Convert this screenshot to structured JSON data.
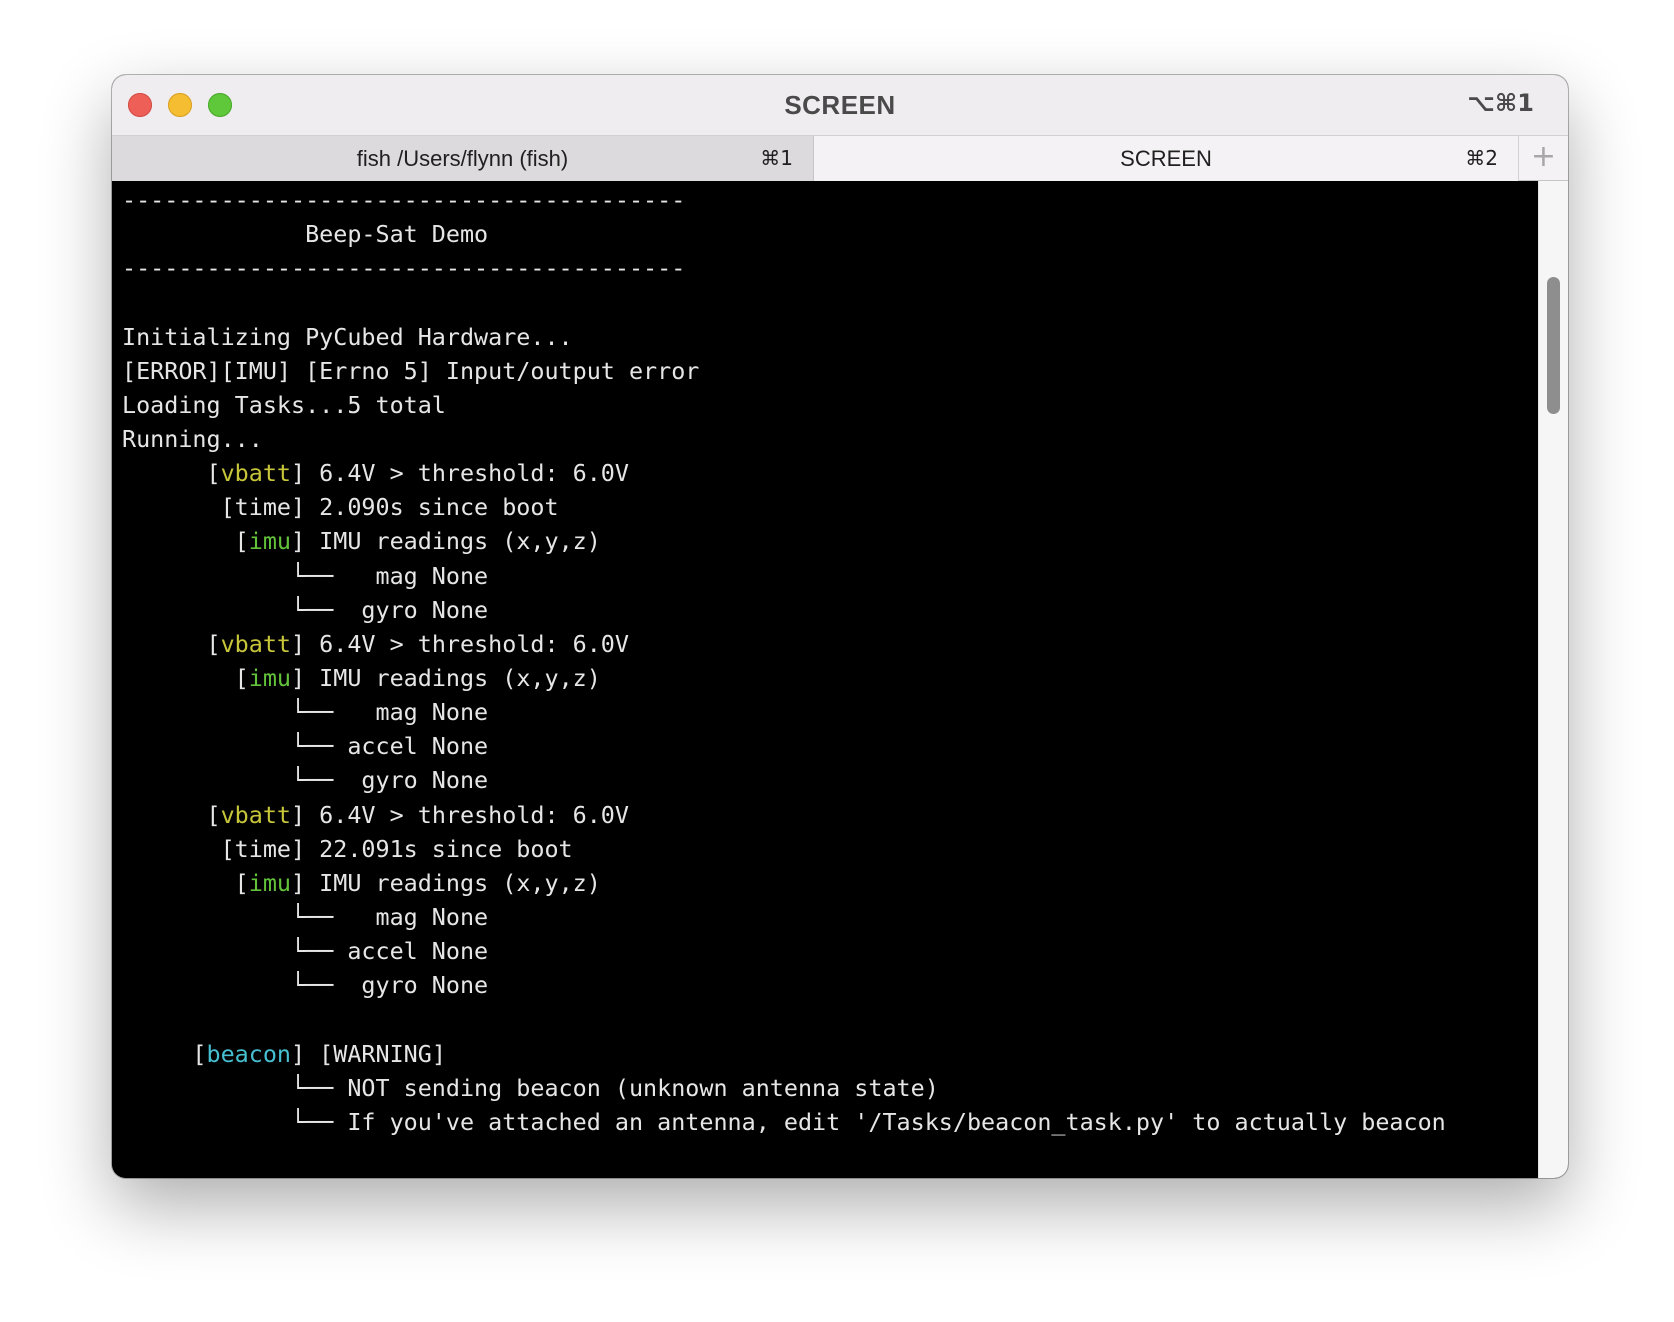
{
  "window": {
    "title": "SCREEN",
    "shortcut": "⌥⌘1"
  },
  "tabs": [
    {
      "label": "fish /Users/flynn (fish)",
      "shortcut": "⌘1",
      "active": false
    },
    {
      "label": "SCREEN",
      "shortcut": "⌘2",
      "active": true
    }
  ],
  "new_tab_glyph": "+",
  "terminal": {
    "lines": [
      {
        "segments": [
          {
            "text": "----------------------------------------"
          }
        ]
      },
      {
        "segments": [
          {
            "text": "             Beep-Sat Demo"
          }
        ]
      },
      {
        "segments": [
          {
            "text": "----------------------------------------"
          }
        ]
      },
      {
        "segments": [
          {
            "text": ""
          }
        ]
      },
      {
        "segments": [
          {
            "text": "Initializing PyCubed Hardware..."
          }
        ]
      },
      {
        "segments": [
          {
            "text": "[ERROR][IMU] [Errno 5] Input/output error"
          }
        ]
      },
      {
        "segments": [
          {
            "text": "Loading Tasks...5 total"
          }
        ]
      },
      {
        "segments": [
          {
            "text": "Running..."
          }
        ]
      },
      {
        "segments": [
          {
            "text": "      ["
          },
          {
            "text": "vbatt",
            "color": "yellow"
          },
          {
            "text": "] 6.4V > threshold: 6.0V"
          }
        ]
      },
      {
        "segments": [
          {
            "text": "       [time] 2.090s since boot"
          }
        ]
      },
      {
        "segments": [
          {
            "text": "        ["
          },
          {
            "text": "imu",
            "color": "green"
          },
          {
            "text": "] IMU readings (x,y,z)"
          }
        ]
      },
      {
        "segments": [
          {
            "text": "            └──   mag None"
          }
        ]
      },
      {
        "segments": [
          {
            "text": "            └──  gyro None"
          }
        ]
      },
      {
        "segments": [
          {
            "text": "      ["
          },
          {
            "text": "vbatt",
            "color": "yellow"
          },
          {
            "text": "] 6.4V > threshold: 6.0V"
          }
        ]
      },
      {
        "segments": [
          {
            "text": "        ["
          },
          {
            "text": "imu",
            "color": "green"
          },
          {
            "text": "] IMU readings (x,y,z)"
          }
        ]
      },
      {
        "segments": [
          {
            "text": "            └──   mag None"
          }
        ]
      },
      {
        "segments": [
          {
            "text": "            └── accel None"
          }
        ]
      },
      {
        "segments": [
          {
            "text": "            └──  gyro None"
          }
        ]
      },
      {
        "segments": [
          {
            "text": "      ["
          },
          {
            "text": "vbatt",
            "color": "yellow"
          },
          {
            "text": "] 6.4V > threshold: 6.0V"
          }
        ]
      },
      {
        "segments": [
          {
            "text": "       [time] 22.091s since boot"
          }
        ]
      },
      {
        "segments": [
          {
            "text": "        ["
          },
          {
            "text": "imu",
            "color": "green"
          },
          {
            "text": "] IMU readings (x,y,z)"
          }
        ]
      },
      {
        "segments": [
          {
            "text": "            └──   mag None"
          }
        ]
      },
      {
        "segments": [
          {
            "text": "            └── accel None"
          }
        ]
      },
      {
        "segments": [
          {
            "text": "            └──  gyro None"
          }
        ]
      },
      {
        "segments": [
          {
            "text": ""
          }
        ]
      },
      {
        "segments": [
          {
            "text": "     ["
          },
          {
            "text": "beacon",
            "color": "cyan"
          },
          {
            "text": "] [WARNING]"
          }
        ]
      },
      {
        "segments": [
          {
            "text": "            └── NOT sending beacon (unknown antenna state)"
          }
        ]
      },
      {
        "segments": [
          {
            "text": "            └── If you've attached an antenna, edit '/Tasks/beacon_task.py' to actually beacon"
          }
        ]
      }
    ]
  },
  "colors": {
    "yellow": "#c7c53a",
    "green": "#62c33a",
    "cyan": "#46bfd0",
    "text": "#e6e6e6",
    "background": "#000000"
  }
}
